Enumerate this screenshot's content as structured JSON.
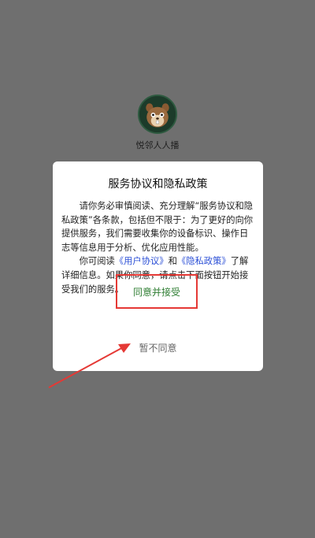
{
  "app": {
    "name": "悦邻人人播",
    "logo_icon": "squirrel-avatar-icon"
  },
  "dialog": {
    "title": "服务协议和隐私政策",
    "para1": "请你务必审慎阅读、充分理解“服务协议和隐私政策”各条款，包括但不限于：为了更好的向你提供服务，我们需要收集你的设备标识、操作日志等信息用于分析、优化应用性能。",
    "para2_prefix": "你可阅读",
    "user_agreement_link": "《用户协议》",
    "para2_and": "和",
    "privacy_policy_link": "《隐私政策》",
    "para2_suffix": "了解详细信息。如果你同意，请点击下面按钮开始接受我们的服务。",
    "agree_label": "同意并接受",
    "disagree_label": "暂不同意"
  },
  "colors": {
    "overlay": "#6f6f6f",
    "agree_text": "#2e7d32",
    "link": "#2b4fd6",
    "annotation_red": "#e53935"
  }
}
